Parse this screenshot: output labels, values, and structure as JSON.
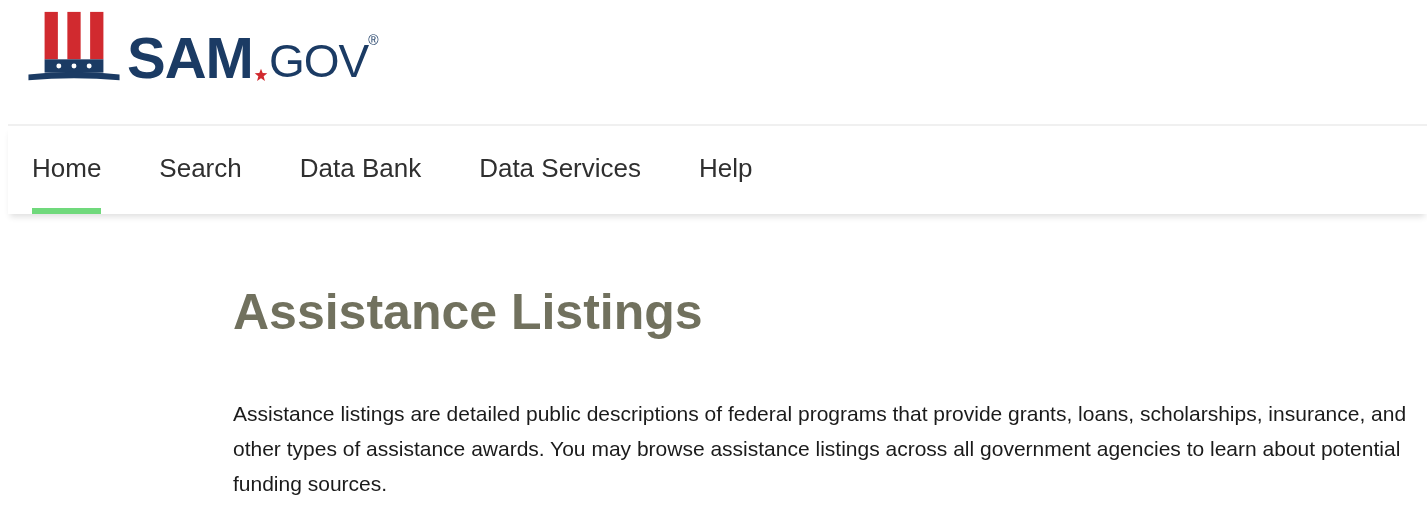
{
  "logo": {
    "primary": "SAM",
    "secondary": "GOV",
    "mark": "®"
  },
  "nav": [
    {
      "label": "Home",
      "selected": true
    },
    {
      "label": "Search",
      "selected": false
    },
    {
      "label": "Data Bank",
      "selected": false
    },
    {
      "label": "Data Services",
      "selected": false
    },
    {
      "label": "Help",
      "selected": false
    }
  ],
  "page": {
    "title": "Assistance Listings",
    "description": "Assistance listings are detailed public descriptions of federal programs that provide grants, loans, scholarships, insurance, and other types of assistance awards. You may browse assistance listings across all government agencies to learn about potential funding sources."
  }
}
